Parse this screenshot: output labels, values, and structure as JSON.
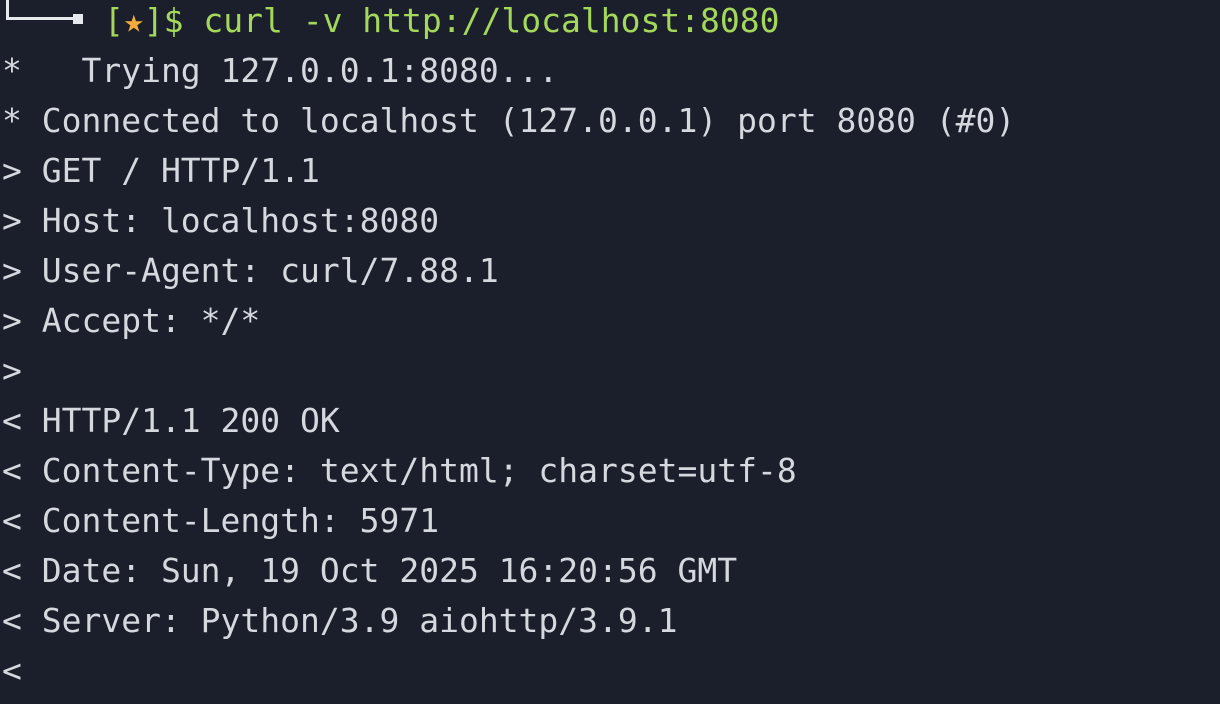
{
  "prompt": {
    "bracket_open": "[",
    "star": "★",
    "bracket_close": "]$ ",
    "command": "curl -v http://localhost:8080"
  },
  "output": [
    "*   Trying 127.0.0.1:8080...",
    "* Connected to localhost (127.0.0.1) port 8080 (#0)",
    "> GET / HTTP/1.1",
    "> Host: localhost:8080",
    "> User-Agent: curl/7.88.1",
    "> Accept: */*",
    ">",
    "< HTTP/1.1 200 OK",
    "< Content-Type: text/html; charset=utf-8",
    "< Content-Length: 5971",
    "< Date: Sun, 19 Oct 2025 16:20:56 GMT",
    "< Server: Python/3.9 aiohttp/3.9.1",
    "<"
  ],
  "colors": {
    "background": "#1b1f2b",
    "text": "#d5d8de",
    "prompt_green": "#a4d85b",
    "star_orange": "#f4ad3d"
  }
}
